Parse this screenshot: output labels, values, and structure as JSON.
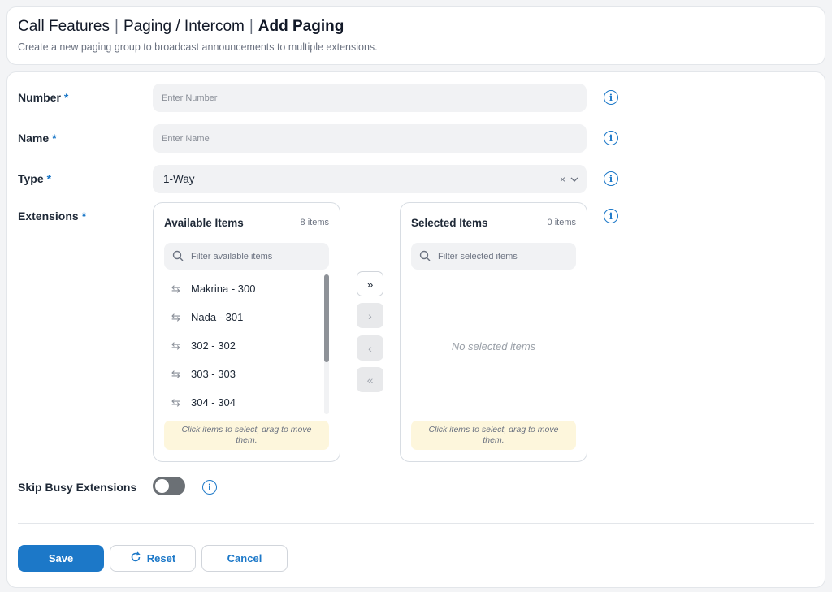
{
  "breadcrumb": {
    "items": [
      "Call Features",
      "Paging / Intercom",
      "Add Paging"
    ]
  },
  "subtitle": "Create a new paging group to broadcast announcements to multiple extensions.",
  "fields": {
    "number": {
      "label": "Number",
      "required_mark": "*",
      "placeholder": "Enter Number"
    },
    "name": {
      "label": "Name",
      "required_mark": "*",
      "placeholder": "Enter Name"
    },
    "type": {
      "label": "Type",
      "required_mark": "*",
      "value": "1-Way",
      "clear_glyph": "×",
      "chevron_glyph": "⌄"
    },
    "extensions": {
      "label": "Extensions",
      "required_mark": "*"
    },
    "skip_busy": {
      "label": "Skip Busy Extensions",
      "enabled": false
    }
  },
  "available": {
    "title": "Available Items",
    "count": "8 items",
    "filter_placeholder": "Filter available items",
    "items": [
      "Makrina - 300",
      "Nada - 301",
      "302 - 302",
      "303 - 303",
      "304 - 304"
    ],
    "hint": "Click items to select, drag to move them."
  },
  "selected": {
    "title": "Selected Items",
    "count": "0 items",
    "filter_placeholder": "Filter selected items",
    "empty_text": "No selected items",
    "hint": "Click items to select, drag to move them."
  },
  "transfer": {
    "move_all_right": "»",
    "move_right": "›",
    "move_left": "‹",
    "move_all_left": "«"
  },
  "info_glyph": "i",
  "move_glyph": "⇆",
  "actions": {
    "save": "Save",
    "reset": "Reset",
    "reset_glyph": "↻",
    "cancel": "Cancel"
  },
  "colors": {
    "accent": "#1c78c8",
    "toggle_off": "#6b7075",
    "hint_bg": "#fdf6dc"
  }
}
